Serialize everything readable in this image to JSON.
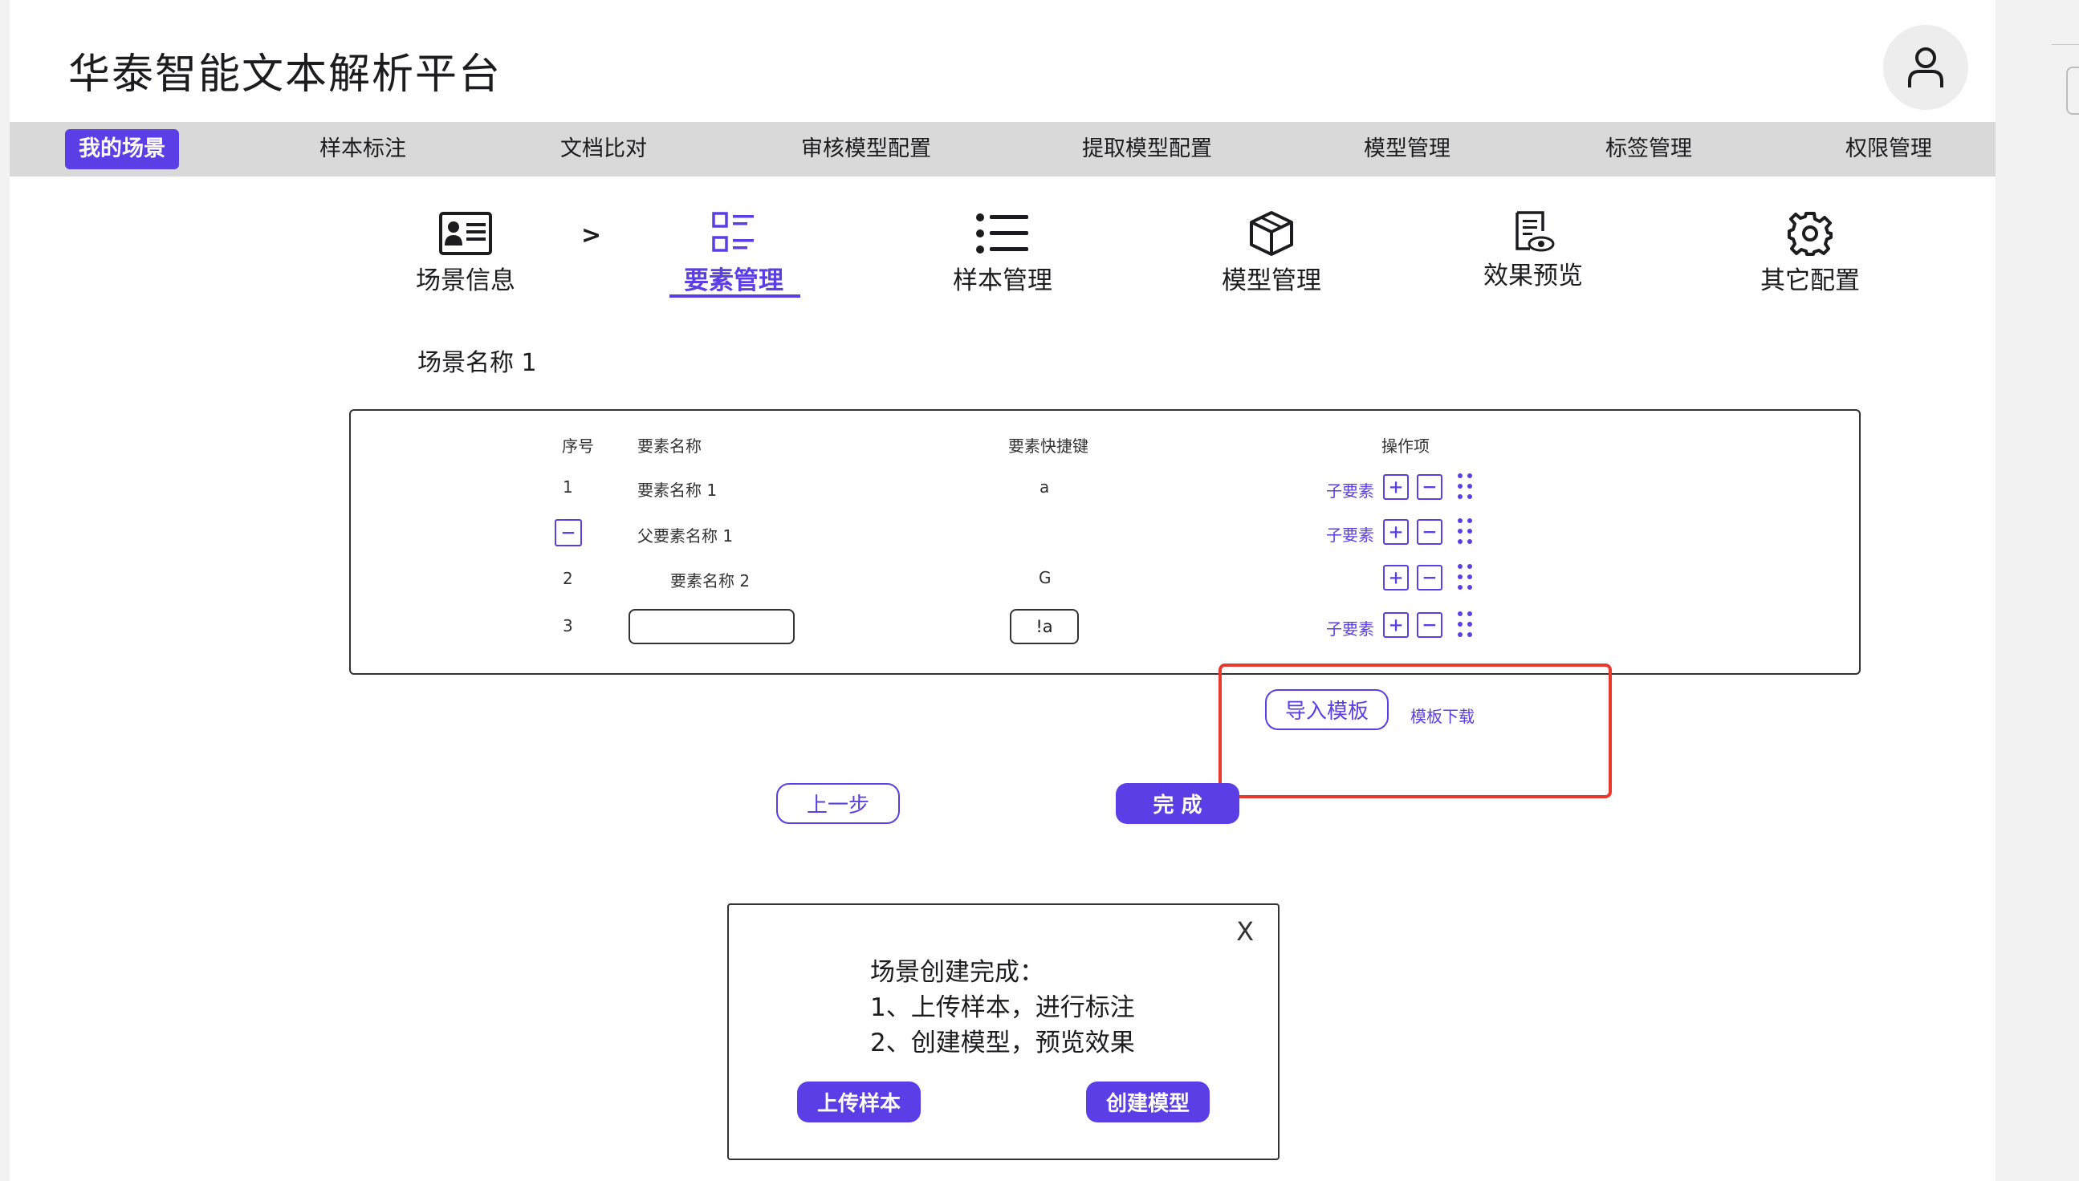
{
  "app": {
    "title": "华泰智能文本解析平台"
  },
  "user": {
    "avatar_icon": "user-icon"
  },
  "nav": {
    "items": [
      {
        "label": "我的场景",
        "active": true
      },
      {
        "label": "样本标注"
      },
      {
        "label": "文档比对"
      },
      {
        "label": "审核模型配置"
      },
      {
        "label": "提取模型配置"
      },
      {
        "label": "模型管理"
      },
      {
        "label": "标签管理"
      },
      {
        "label": "权限管理"
      }
    ]
  },
  "steps": {
    "separator": ">",
    "items": [
      {
        "label": "场景信息",
        "icon": "id-card-icon"
      },
      {
        "label": "要素管理",
        "icon": "element-list-icon",
        "active": true
      },
      {
        "label": "样本管理",
        "icon": "bullet-list-icon"
      },
      {
        "label": "模型管理",
        "icon": "cube-icon"
      },
      {
        "label": "效果预览",
        "icon": "document-eye-icon"
      },
      {
        "label": "其它配置",
        "icon": "gear-icon"
      }
    ]
  },
  "scene": {
    "name": "场景名称 1"
  },
  "table": {
    "headers": {
      "index": "序号",
      "name": "要素名称",
      "shortcut": "要素快捷键",
      "actions": "操作项"
    },
    "rows": [
      {
        "index": "1",
        "name": "要素名称 1",
        "shortcut": "a",
        "child_link": "子要素"
      },
      {
        "index": "",
        "name": "父要素名称 1",
        "shortcut": "",
        "child_link": "子要素",
        "collapse": "−"
      },
      {
        "index": "2",
        "name": "要素名称 2",
        "shortcut": "G",
        "child_link": ""
      },
      {
        "index": "3",
        "name": "",
        "shortcut": "!a",
        "child_link": "子要素"
      }
    ],
    "add_symbol": "+",
    "remove_symbol": "−"
  },
  "template": {
    "import_label": "导入模板",
    "download_label": "模板下载"
  },
  "footer": {
    "prev_label": "上一步",
    "done_label": "完 成"
  },
  "dialog": {
    "close": "X",
    "title": "场景创建完成：",
    "line1": "1、上传样本，进行标注",
    "line2": "2、创建模型，预览效果",
    "upload_label": "上传样本",
    "create_label": "创建模型"
  },
  "colors": {
    "accent": "#5b3ee6",
    "highlight": "#e8392c",
    "navbar": "#d9d9d9"
  }
}
